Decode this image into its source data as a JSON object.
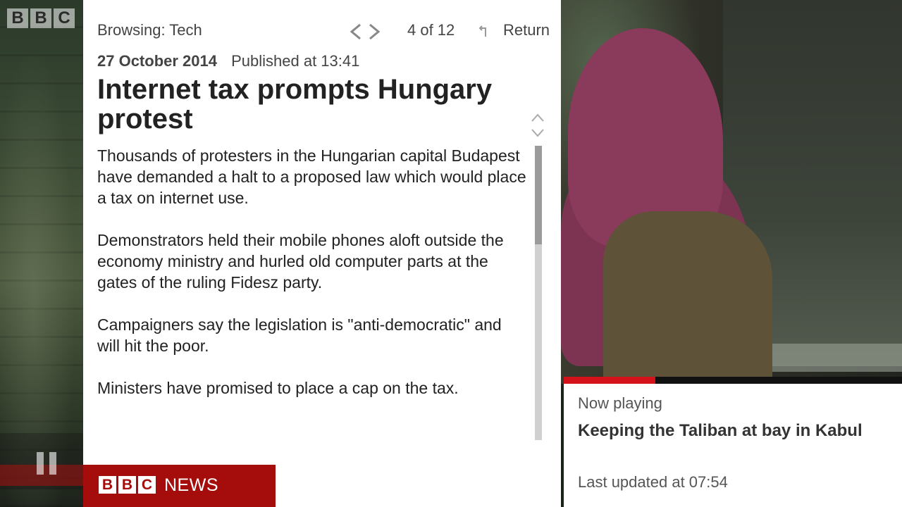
{
  "left_video": {
    "logo_letters": [
      "B",
      "B",
      "C"
    ]
  },
  "article": {
    "browsing": "Browsing: Tech",
    "pager": "4 of 12",
    "return_label": "Return",
    "date": "27 October 2014",
    "published": "Published at 13:41",
    "headline": "Internet tax prompts Hungary protest",
    "paragraphs": [
      "Thousands of protesters in the Hungarian capital Budapest have demanded a halt to a proposed law which would place a tax on internet use.",
      "Demonstrators held their mobile phones aloft outside the economy ministry and hurled old computer parts at the gates of the ruling Fidesz party.",
      "Campaigners say the legislation is \"anti-democratic\" and will hit the poor.",
      "Ministers have promised to place a cap on the tax."
    ],
    "scroll_position": 0.0
  },
  "brand": {
    "letters": [
      "B",
      "B",
      "C"
    ],
    "news": "NEWS",
    "color": "#a50c0c"
  },
  "now_playing": {
    "label": "Now playing",
    "title": "Keeping the Taliban at bay in Kabul",
    "updated": "Last updated at 07:54",
    "progress": 0.27,
    "progress_color": "#d4121a"
  },
  "icons": {
    "nav_prev": "chevron-left-icon",
    "nav_next": "chevron-right-icon",
    "return": "return-arrow-icon",
    "scroll_up": "chevron-up-icon",
    "scroll_down": "chevron-down-icon",
    "pause": "pause-icon"
  }
}
